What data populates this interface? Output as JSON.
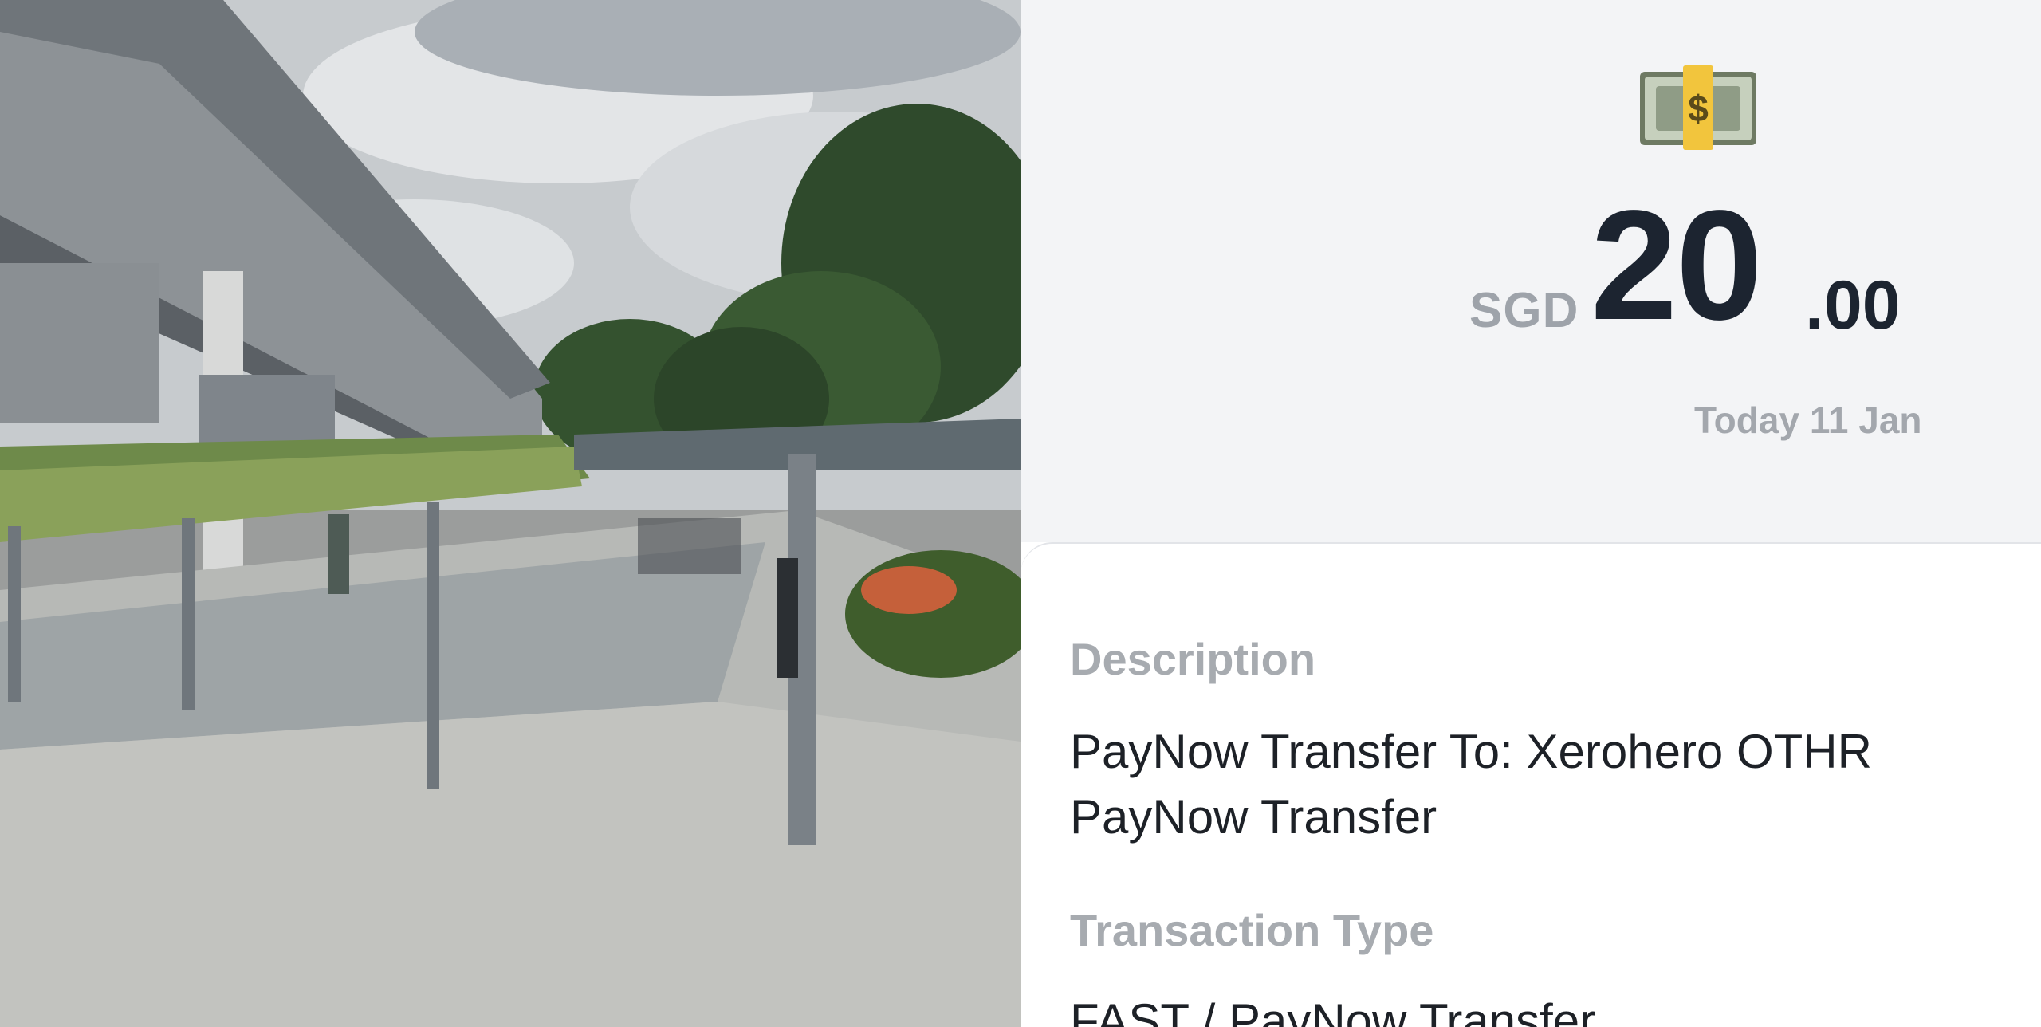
{
  "photo": {
    "scene": "street-view-covered-walkway-under-elevated-rail",
    "icon": "street-photo"
  },
  "transaction": {
    "icon": "money-bag-icon",
    "currency": "SGD",
    "amount_major": "20",
    "amount_minor": ".00",
    "date": "Today 11 Jan",
    "description_label": "Description",
    "description_line1": "PayNow Transfer To: Xerohero OTHR",
    "description_line2": "PayNow Transfer",
    "type_label": "Transaction Type",
    "type_value": "FAST / PayNow Transfer"
  },
  "colors": {
    "amount": "#1c2430",
    "muted": "#9ea3aa",
    "panel_bg": "#f3f4f6"
  }
}
